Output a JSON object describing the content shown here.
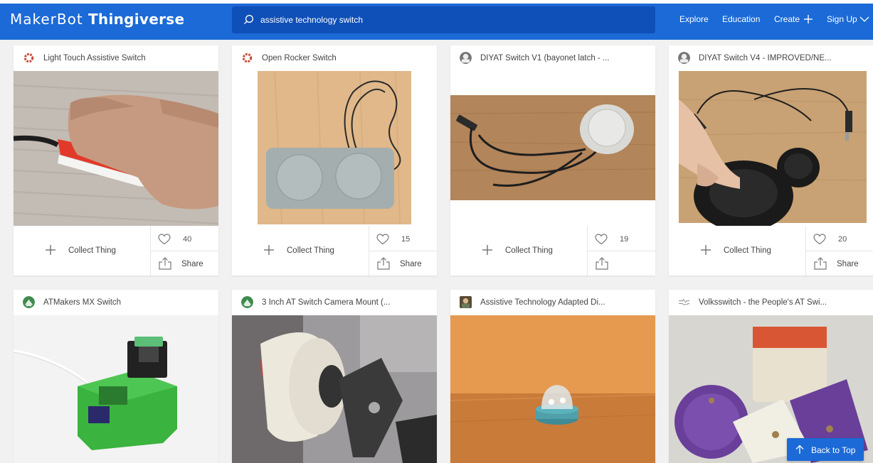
{
  "header": {
    "logo_maker": "MakerBot",
    "logo_product": "Thingiverse",
    "search_value": "assistive technology switch",
    "nav": {
      "explore": "Explore",
      "education": "Education",
      "create": "Create",
      "signup": "Sign Up"
    }
  },
  "actions": {
    "collect_label": "Collect Thing",
    "share_label": "Share"
  },
  "cards": [
    {
      "title": "Light Touch Assistive Switch",
      "likes": "40",
      "avatar_icon": "gear-icon",
      "share_label": "Share"
    },
    {
      "title": "Open Rocker Switch",
      "likes": "15",
      "avatar_icon": "gear-icon",
      "share_label": "Share"
    },
    {
      "title": "DIYAT Switch V1 (bayonet latch - ...",
      "likes": "19",
      "avatar_icon": "user-icon",
      "share_label": ""
    },
    {
      "title": "DIYAT Switch V4 - IMPROVED/NE...",
      "likes": "20",
      "avatar_icon": "user-icon",
      "share_label": "Share"
    },
    {
      "title": "ATMakers MX Switch",
      "avatar_icon": "avatar-icon"
    },
    {
      "title": "3 Inch AT Switch Camera Mount (...",
      "avatar_icon": "avatar-icon"
    },
    {
      "title": "Assistive Technology Adapted Di...",
      "avatar_icon": "avatar-icon"
    },
    {
      "title": "Volksswitch - the People's AT Swi...",
      "avatar_icon": "sketch-icon"
    }
  ],
  "back_to_top": "Back to Top",
  "colors": {
    "brand_blue": "#1b6ad7",
    "search_bg": "#0f4fb8",
    "page_bg": "#f1f1f1"
  }
}
